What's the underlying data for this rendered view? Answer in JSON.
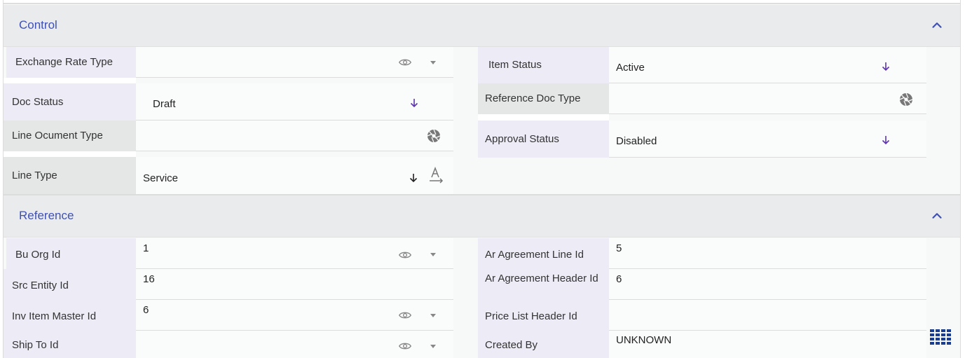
{
  "sections": {
    "control": {
      "title": "Control",
      "fields": {
        "exchange_rate_type": {
          "label": "Exchange Rate Type",
          "value": ""
        },
        "doc_status": {
          "label": "Doc Status",
          "value": "Draft"
        },
        "line_ocument_type": {
          "label": "Line Ocument Type",
          "value": ""
        },
        "line_type": {
          "label": "Line Type",
          "value": "Service"
        },
        "item_status": {
          "label": "Item Status",
          "value": "Active"
        },
        "reference_doc_type": {
          "label": "Reference Doc Type",
          "value": ""
        },
        "approval_status": {
          "label": "Approval Status",
          "value": "Disabled"
        }
      }
    },
    "reference": {
      "title": "Reference",
      "fields": {
        "bu_org_id": {
          "label": "Bu Org Id",
          "value": "1"
        },
        "src_entity_id": {
          "label": "Src Entity Id",
          "value": "16"
        },
        "inv_item_master_id": {
          "label": "Inv Item Master Id",
          "value": "6"
        },
        "ship_to_id": {
          "label": "Ship To Id",
          "value": ""
        },
        "ar_agreement_line_id": {
          "label": "Ar Agreement Line Id",
          "value": "5"
        },
        "ar_agreement_header_id": {
          "label": "Ar Agreement Header Id",
          "value": "6"
        },
        "price_list_header_id": {
          "label": "Price List Header Id",
          "value": ""
        },
        "created_by": {
          "label": "Created By",
          "value": "UNKNOWN"
        }
      }
    }
  },
  "icons": {
    "eye": "eye-icon",
    "dropdown": "caret-down-icon",
    "arrow_down": "arrow-down-icon",
    "aperture": "aperture-icon",
    "text_direction": "text-format-icon",
    "chevron_up": "chevron-up-icon",
    "grid": "grid-icon"
  },
  "colors": {
    "accent": "#3f51b5",
    "purple_arrow": "#5e35b1",
    "label_lavender": "#ecebf6",
    "label_gray": "#e5e6e6",
    "header_bg": "#e9ebec",
    "grid_icon": "#1a3d8f"
  }
}
